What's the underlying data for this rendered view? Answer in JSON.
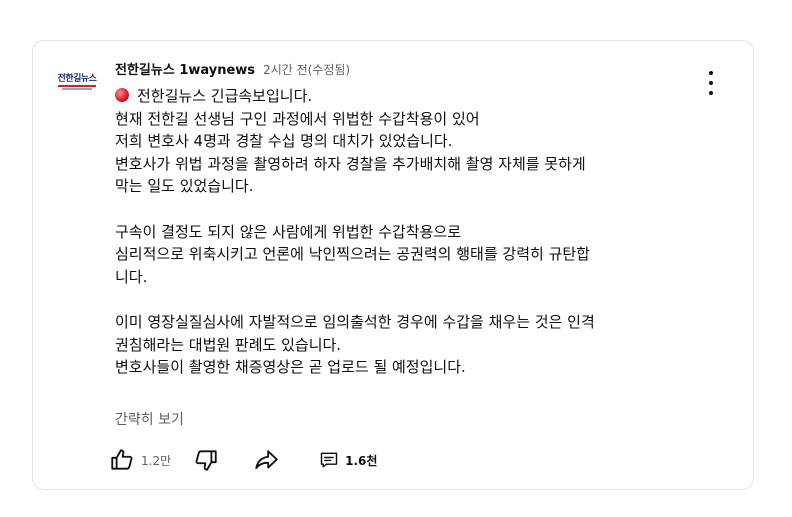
{
  "comment": {
    "avatar_text": "전한길뉴스",
    "channel": "전한길뉴스 1waynews",
    "time": "2시간 전(수정됨)",
    "lines": [
      "전한길뉴스 긴급속보입니다.",
      "현재 전한길 선생님 구인 과정에서 위법한 수갑착용이 있어",
      "저희 변호사 4명과 경찰 수십 명의 대치가 있었습니다.",
      "변호사가 위법 과정을 촬영하려 하자 경찰을 추가배치해 촬영 자체를 못하게",
      "막는 일도 있었습니다.",
      "구속이 결정도 되지 않은 사람에게 위법한 수갑착용으로",
      "심리적으로 위축시키고 언론에 낙인찍으려는 공권력의 행태를 강력히 규탄합",
      "니다.",
      "이미 영장실질심사에 자발적으로 임의출석한 경우에 수갑을 채우는 것은 인격",
      "권침해라는 대법원 판례도 있습니다.",
      "변호사들이 촬영한 채증영상은 곧 업로드 될 예정입니다."
    ],
    "read_less": "간략히 보기",
    "like_count": "1.2만",
    "reply_count": "1.6천",
    "emoji_icon": "red-circle-icon"
  }
}
